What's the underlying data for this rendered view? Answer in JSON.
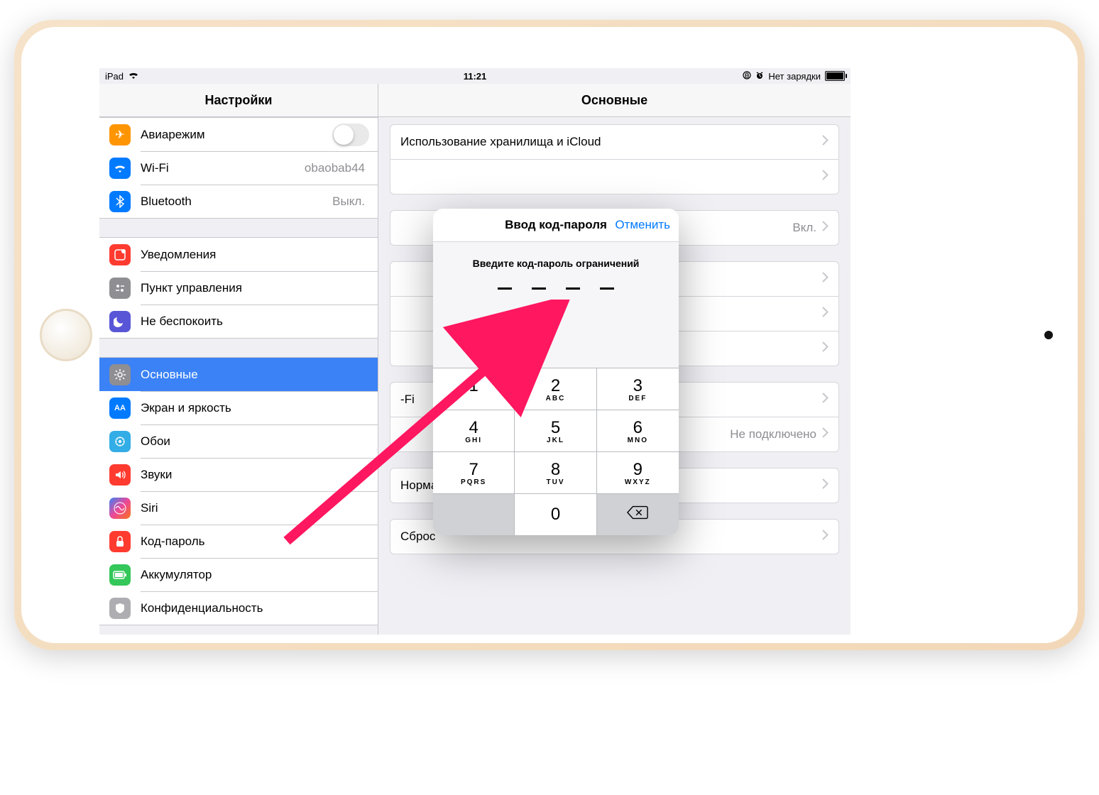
{
  "status_bar": {
    "device": "iPad",
    "time": "11:21",
    "charging_text": "Нет зарядки"
  },
  "left_pane": {
    "title": "Настройки"
  },
  "right_pane": {
    "title": "Основные"
  },
  "sidebar": {
    "airplane": "Авиарежим",
    "wifi": "Wi-Fi",
    "wifi_value": "obaobab44",
    "bluetooth": "Bluetooth",
    "bluetooth_value": "Выкл.",
    "notifications": "Уведомления",
    "control_center": "Пункт управления",
    "dnd": "Не беспокоить",
    "general": "Основные",
    "display": "Экран и яркость",
    "wallpaper": "Обои",
    "sounds": "Звуки",
    "siri": "Siri",
    "passcode": "Код-пароль",
    "battery": "Аккумулятор",
    "privacy": "Конфиденциальность"
  },
  "detail": {
    "storage": "Использование хранилища и iCloud",
    "on_value": "Вкл.",
    "wifi_suffix": "-Fi",
    "not_connected": "Не подключено",
    "regulatory": "Нормативы",
    "reset": "Сброс"
  },
  "popup": {
    "title": "Ввод код-пароля",
    "cancel": "Отменить",
    "prompt": "Введите код-пароль ограничений"
  },
  "keypad": {
    "k1": "1",
    "k2": "2",
    "k3": "3",
    "k4": "4",
    "k5": "5",
    "k6": "6",
    "k7": "7",
    "k8": "8",
    "k9": "9",
    "k0": "0",
    "s2": "ABC",
    "s3": "DEF",
    "s4": "GHI",
    "s5": "JKL",
    "s6": "MNO",
    "s7": "PQRS",
    "s8": "TUV",
    "s9": "WXYZ"
  }
}
